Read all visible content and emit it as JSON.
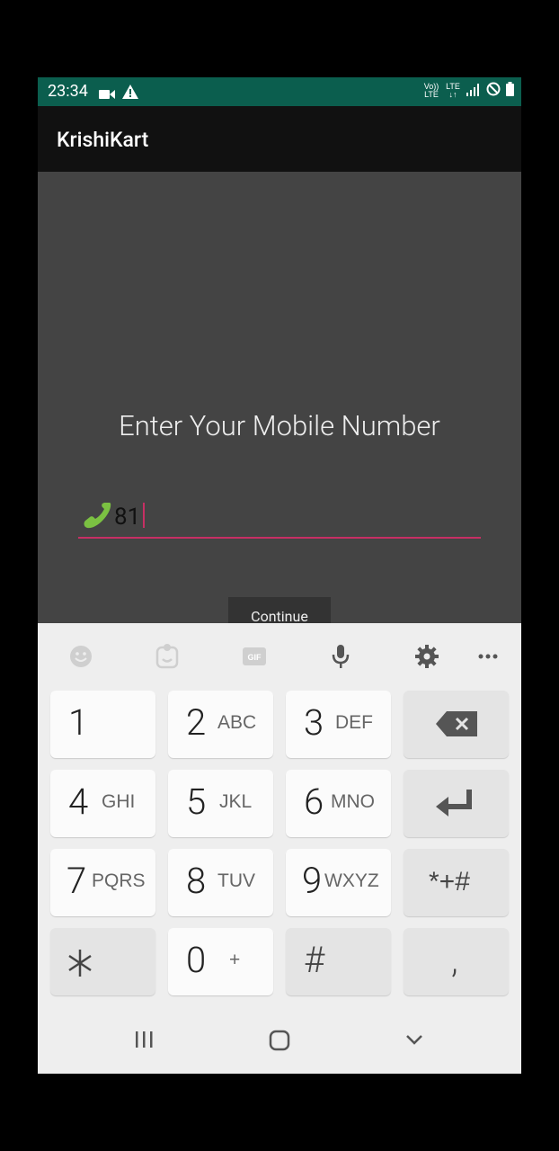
{
  "status_bar": {
    "time": "23:34",
    "volte": "Vo)) LTE",
    "lte": "LTE"
  },
  "app": {
    "title": "KrishiKart"
  },
  "form": {
    "prompt": "Enter Your Mobile Number",
    "phone_value": "81",
    "continue_label": "Continue"
  },
  "keyboard": {
    "keys": [
      {
        "num": "1",
        "sub": ""
      },
      {
        "num": "2",
        "sub": "ABC"
      },
      {
        "num": "3",
        "sub": "DEF"
      },
      {
        "num": "4",
        "sub": "GHI"
      },
      {
        "num": "5",
        "sub": "JKL"
      },
      {
        "num": "6",
        "sub": "MNO"
      },
      {
        "num": "7",
        "sub": "PQRS"
      },
      {
        "num": "8",
        "sub": "TUV"
      },
      {
        "num": "9",
        "sub": "WXYZ"
      },
      {
        "num": "0",
        "sub": "+"
      }
    ],
    "sym_label": "*+#",
    "hash_label": "#",
    "comma_label": ",",
    "star_label": "*",
    "gif_label": "GIF"
  },
  "colors": {
    "status_bar": "#0b5e4e",
    "accent": "#c72f64",
    "phone_icon": "#7bc142"
  }
}
